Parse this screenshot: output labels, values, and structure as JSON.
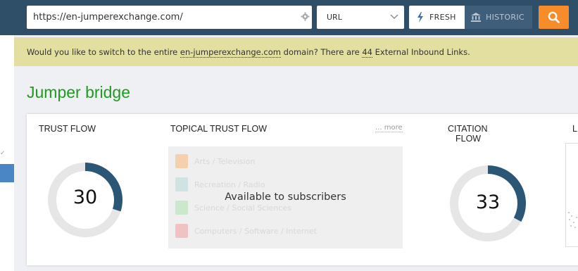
{
  "header": {
    "url_value": "https://en-jumperexchange.com/",
    "scope_select": "URL",
    "fresh_label": "FRESH",
    "historic_label": "HISTORIC"
  },
  "notice": {
    "prefix": "Would you like to switch to the entire ",
    "domain": "en-jumperexchange.com",
    "middle": " domain? There are ",
    "count": "44",
    "suffix": " External Inbound Links."
  },
  "page_title": "Jumper bridge",
  "metrics": {
    "trust_flow": {
      "label": "TRUST FLOW",
      "value": "30",
      "fraction": 0.3
    },
    "topical_trust_flow": {
      "label": "TOPICAL TRUST FLOW",
      "more_label": "... more",
      "overlay_text": "Available to subscribers",
      "topics": [
        {
          "name": "Arts / Television",
          "color": "#f6cfae"
        },
        {
          "name": "Recreation / Radio",
          "color": "#cfe3e2"
        },
        {
          "name": "Science / Social Sciences",
          "color": "#cbe8cd"
        },
        {
          "name": "Computers / Software / Internet",
          "color": "#f1c2c2"
        }
      ]
    },
    "citation_flow": {
      "label_line1": "CITATION",
      "label_line2": "FLOW",
      "value": "33",
      "fraction": 0.33
    },
    "cut_off_label": "L"
  },
  "colors": {
    "topbar": "#2f4e68",
    "search_button": "#f68c2a",
    "title_green": "#1f9c1f",
    "donut_fill": "#2b5675",
    "donut_track": "#e6e6e6"
  }
}
